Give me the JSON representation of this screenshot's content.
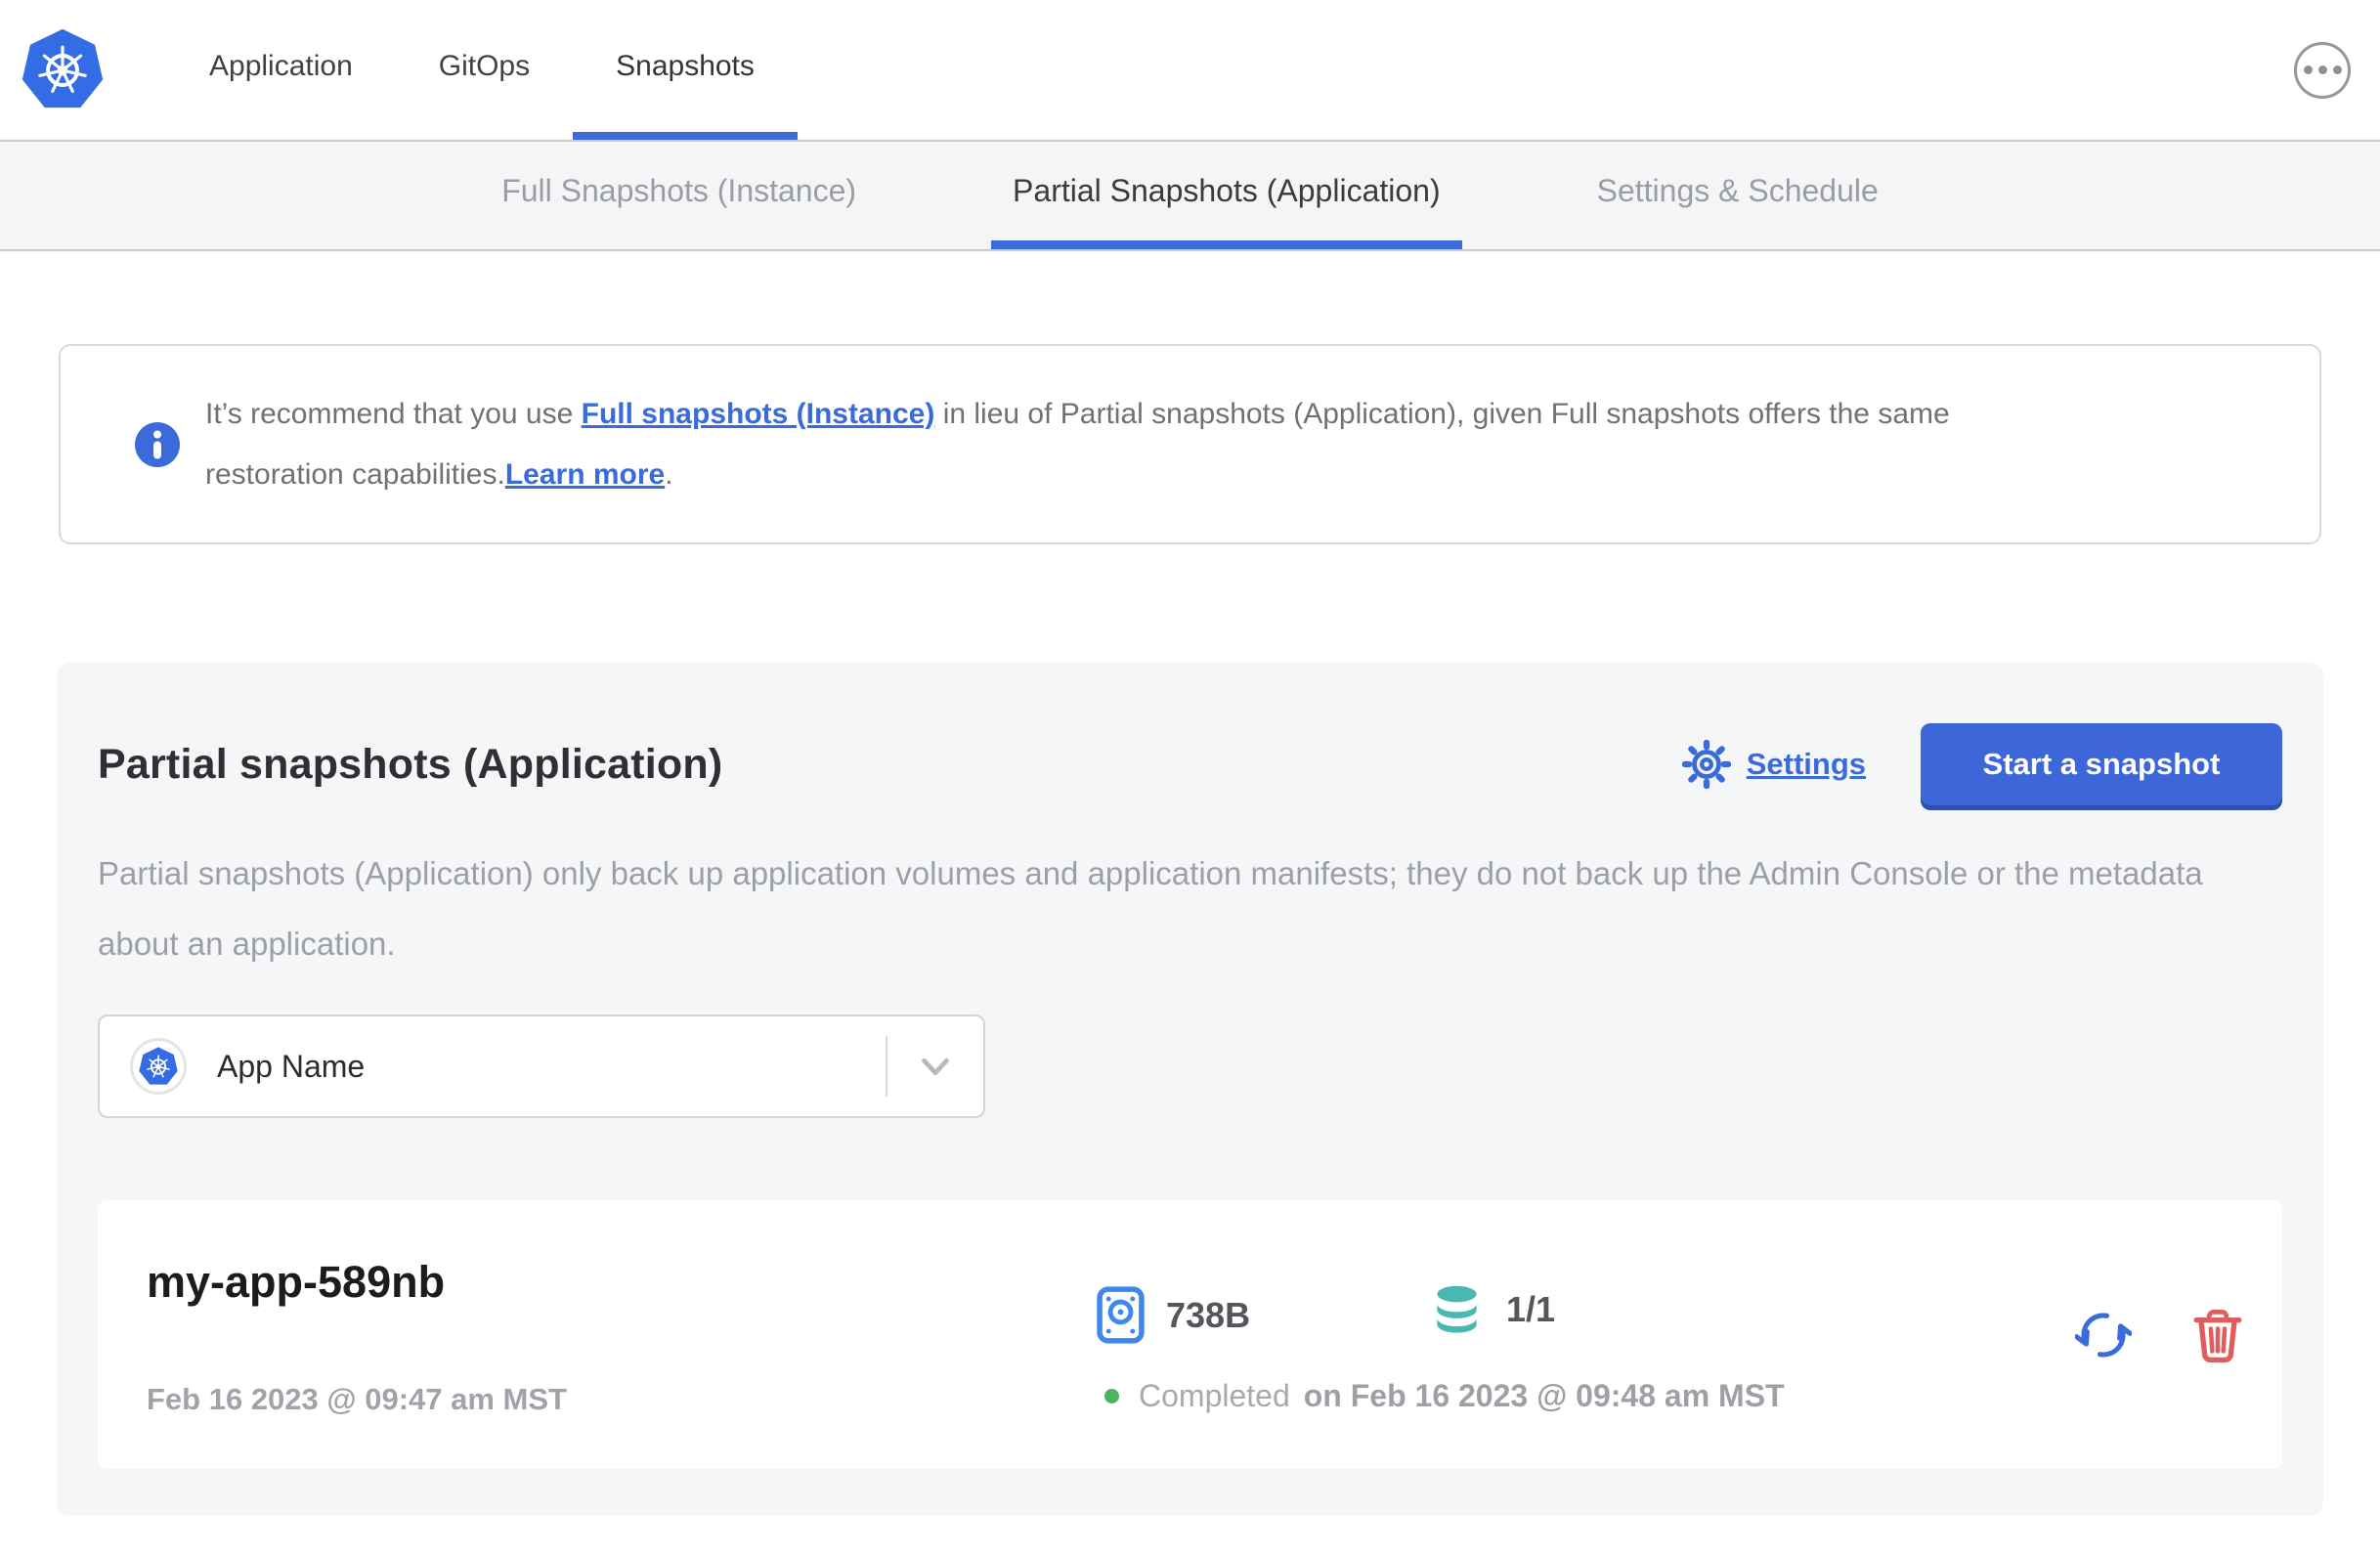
{
  "colors": {
    "accent_blue": "#3b6bdb",
    "button_blue": "#3d66d8",
    "disk_blue": "#3d87ee",
    "database_teal": "#49b8b0",
    "status_green": "#4cb35f",
    "delete_red": "#e05d5d",
    "panel_gray": "#f5f6f8"
  },
  "header": {
    "nav_items": [
      {
        "label": "Application"
      },
      {
        "label": "GitOps"
      },
      {
        "label": "Snapshots"
      }
    ]
  },
  "subnav": {
    "tabs": [
      "Full Snapshots (Instance)",
      "Partial Snapshots (Application)",
      "Settings & Schedule"
    ]
  },
  "banner": {
    "text_before_link1": "It’s recommend that you use ",
    "link1": "Full snapshots (Instance)",
    "text_middle": " in lieu of Partial snapshots (Application), given Full snapshots offers the same restoration capabilities.",
    "link2": "Learn more",
    "text_after": "."
  },
  "panel": {
    "title": "Partial snapshots (Application)",
    "settings_label": "Settings",
    "start_button": "Start a snapshot",
    "description": "Partial snapshots (Application) only back up application volumes and application manifests; they do not back up the Admin Console or the metadata about an application.",
    "app_selector": {
      "value": "App Name"
    }
  },
  "snapshot": {
    "name": "my-app-589nb",
    "started": "Feb 16 2023 @ 09:47 am MST",
    "size": "738B",
    "volumes": "1/1",
    "status": "Completed",
    "completed_on": "on Feb 16 2023 @ 09:48 am MST"
  }
}
